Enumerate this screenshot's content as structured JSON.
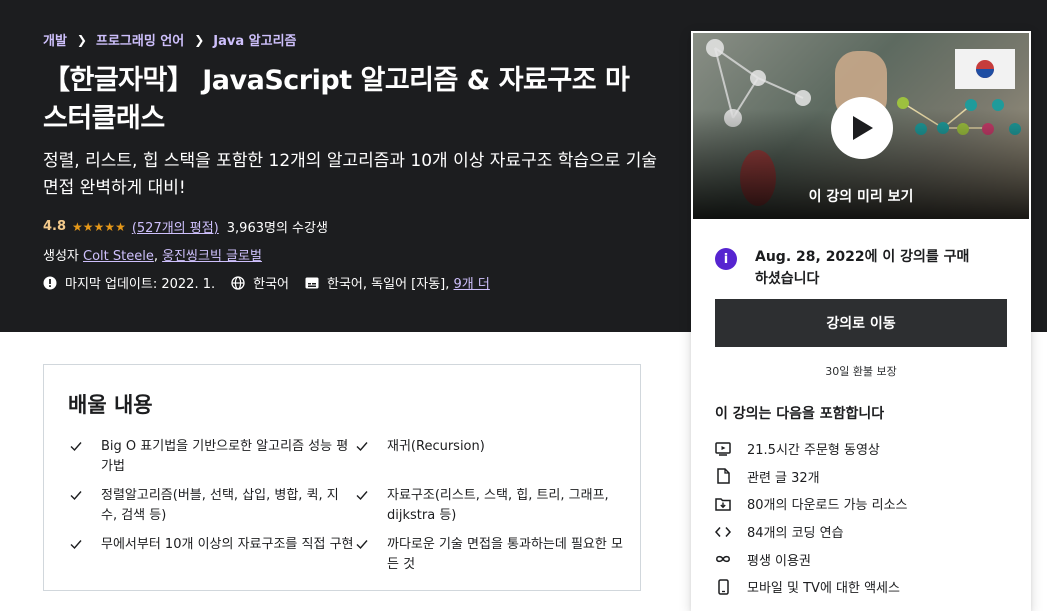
{
  "breadcrumb": [
    "개발",
    "프로그래밍 언어",
    "Java 알고리즘"
  ],
  "course": {
    "title": "【한글자막】 JavaScript 알고리즘 & 자료구조 마스터클래스",
    "subtitle": "정렬, 리스트, 힙 스택을 포함한 12개의 알고리즘과 10개 이상 자료구조 학습으로 기술 면접 완벽하게 대비!",
    "rating": "4.8",
    "stars": "★★★★★",
    "rating_count": "(527개의 평점)",
    "students": "3,963명의 수강생",
    "creator_label": "생성자",
    "creators": [
      "Colt Steele",
      "웅진씽크빅 글로벌"
    ],
    "last_updated": "마지막 업데이트: 2022. 1.",
    "language": "한국어",
    "captions": "한국어, 독일어 [자동],",
    "captions_more": "9개 더"
  },
  "card": {
    "preview_label": "이 강의 미리 보기",
    "purchased_text": "Aug. 28, 2022에 이 강의를 구매하셨습니다",
    "go_button": "강의로 이동",
    "guarantee": "30일 환불 보장",
    "includes_title": "이 강의는 다음을 포함합니다",
    "includes": [
      {
        "icon": "video-icon",
        "text": "21.5시간 주문형 동영상"
      },
      {
        "icon": "file-icon",
        "text": "관련 글 32개"
      },
      {
        "icon": "folder-download-icon",
        "text": "80개의 다운로드 가능 리소스"
      },
      {
        "icon": "code-icon",
        "text": "84개의 코딩 연습"
      },
      {
        "icon": "infinity-icon",
        "text": "평생 이용권"
      },
      {
        "icon": "mobile-icon",
        "text": "모바일 및 TV에 대한 액세스"
      }
    ]
  },
  "learn": {
    "title": "배울 내용",
    "items": [
      "Big O 표기법을 기반으로한 알고리즘 성능 평가법",
      "재귀(Recursion)",
      "정렬알고리즘(버블, 선택, 삽입, 병합, 퀵, 지수, 검색 등)",
      "자료구조(리스트, 스택, 힙, 트리, 그래프, dijkstra 등)",
      "무에서부터 10개 이상의 자료구조를 직접 구현",
      "까다로운 기술 면접을 통과하는데 필요한 모든 것"
    ]
  },
  "colors": {
    "hero_bg": "#1c1d1f",
    "link_purple": "#cec0fc",
    "star": "#e59819",
    "rating": "#f3ca8c",
    "info_purple": "#5624d0",
    "button_dark": "#2d2f31"
  }
}
